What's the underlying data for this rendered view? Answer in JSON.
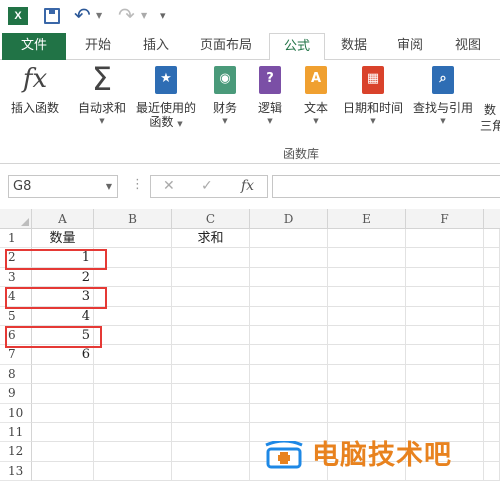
{
  "qat": {
    "app_logo": "X",
    "save_icon": "save-icon",
    "undo_icon": "undo-icon",
    "redo_icon": "redo-icon"
  },
  "tabs": [
    "文件",
    "开始",
    "插入",
    "页面布局",
    "公式",
    "数据",
    "审阅",
    "视图"
  ],
  "active_tab": "公式",
  "ribbon": {
    "buttons": [
      {
        "label": "插入函数",
        "icon": "fx-icon"
      },
      {
        "label": "自动求和",
        "icon": "sigma-icon",
        "dropdown": true
      },
      {
        "label": "最近使用的",
        "label2": "函数",
        "icon": "star-book-icon",
        "dropdown": true
      },
      {
        "label": "财务",
        "icon": "coins-book-icon",
        "dropdown": true
      },
      {
        "label": "逻辑",
        "icon": "question-book-icon",
        "dropdown": true
      },
      {
        "label": "文本",
        "icon": "text-book-icon",
        "dropdown": true
      },
      {
        "label": "日期和时间",
        "icon": "calendar-book-icon",
        "dropdown": true
      },
      {
        "label": "查找与引用",
        "icon": "search-book-icon",
        "dropdown": true
      },
      {
        "label": "数",
        "label2": "三角",
        "icon": "math-book-icon"
      }
    ],
    "group_label": "函数库"
  },
  "formula_bar": {
    "name_box": "G8",
    "cancel": "✕",
    "enter": "✓",
    "fx": "fx",
    "value": ""
  },
  "sheet": {
    "columns": [
      "A",
      "B",
      "C",
      "D",
      "E",
      "F"
    ],
    "rows": [
      "1",
      "2",
      "3",
      "4",
      "5",
      "6",
      "7",
      "8",
      "9",
      "10",
      "11",
      "12",
      "13"
    ],
    "cells": {
      "A1": "数量",
      "C1": "求和",
      "A2": "1",
      "A3": "2",
      "A4": "3",
      "A5": "4",
      "A6": "5",
      "A7": "6"
    },
    "highlight_color": "#e53935"
  },
  "watermark": {
    "text": "电脑技术吧",
    "color": "#e8821e"
  }
}
